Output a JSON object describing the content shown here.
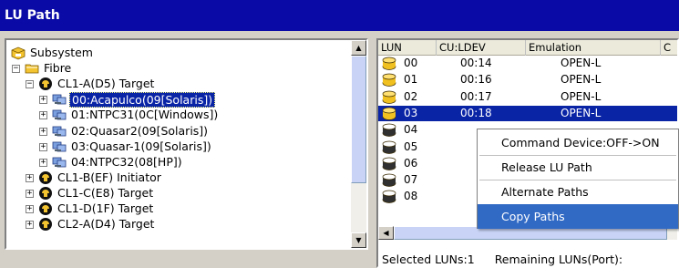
{
  "window": {
    "title": "LU Path"
  },
  "tree": {
    "nodes": [
      {
        "label": "Subsystem",
        "icon": "subsystem-icon",
        "expander": ""
      },
      {
        "label": "Fibre",
        "icon": "fibre-folder-icon",
        "expander": "−"
      },
      {
        "label": "CL1-A(D5) Target",
        "icon": "port-icon",
        "expander": "−"
      },
      {
        "label": "00:Acapulco(09[Solaris])",
        "icon": "host-group-icon",
        "expander": "+",
        "selected": true
      },
      {
        "label": "01:NTPC31(0C[Windows])",
        "icon": "host-group-icon",
        "expander": "+"
      },
      {
        "label": "02:Quasar2(09[Solaris])",
        "icon": "host-group-icon",
        "expander": "+"
      },
      {
        "label": "03:Quasar-1(09[Solaris])",
        "icon": "host-group-icon",
        "expander": "+"
      },
      {
        "label": "04:NTPC32(08[HP])",
        "icon": "host-group-icon",
        "expander": "+"
      },
      {
        "label": "CL1-B(EF) Initiator",
        "icon": "port-icon",
        "expander": "+"
      },
      {
        "label": "CL1-C(E8) Target",
        "icon": "port-icon",
        "expander": "+"
      },
      {
        "label": "CL1-D(1F) Target",
        "icon": "port-icon",
        "expander": "+"
      },
      {
        "label": "CL2-A(D4) Target",
        "icon": "port-icon",
        "expander": "+"
      }
    ]
  },
  "table": {
    "columns": [
      "LUN",
      "CU:LDEV",
      "Emulation",
      "C"
    ],
    "rows": [
      {
        "lun": "00",
        "culdev": "00:14",
        "emulation": "OPEN-L",
        "defined": true
      },
      {
        "lun": "01",
        "culdev": "00:16",
        "emulation": "OPEN-L",
        "defined": true
      },
      {
        "lun": "02",
        "culdev": "00:17",
        "emulation": "OPEN-L",
        "defined": true
      },
      {
        "lun": "03",
        "culdev": "00:18",
        "emulation": "OPEN-L",
        "defined": true,
        "selected": true
      },
      {
        "lun": "04",
        "culdev": "",
        "emulation": "",
        "defined": false
      },
      {
        "lun": "05",
        "culdev": "",
        "emulation": "",
        "defined": false
      },
      {
        "lun": "06",
        "culdev": "",
        "emulation": "",
        "defined": false
      },
      {
        "lun": "07",
        "culdev": "",
        "emulation": "",
        "defined": false
      },
      {
        "lun": "08",
        "culdev": "",
        "emulation": "",
        "defined": false
      }
    ]
  },
  "status": {
    "selected_luns": "Selected LUNs:1",
    "remaining_luns": "Remaining LUNs(Port):"
  },
  "context_menu": {
    "items": [
      {
        "label": "Command Device:OFF->ON",
        "highlighted": false
      },
      {
        "label": "Release LU Path",
        "highlighted": false
      },
      {
        "label": "Alternate Paths",
        "highlighted": false
      },
      {
        "label": "Copy Paths",
        "highlighted": true
      }
    ]
  },
  "colors": {
    "title_bar": "#0a0aa6",
    "selection": "#0a24a6",
    "menu_highlight": "#316ac5",
    "lun_icon_defined": "#f0c020",
    "lun_icon_undefined": "#303030"
  }
}
